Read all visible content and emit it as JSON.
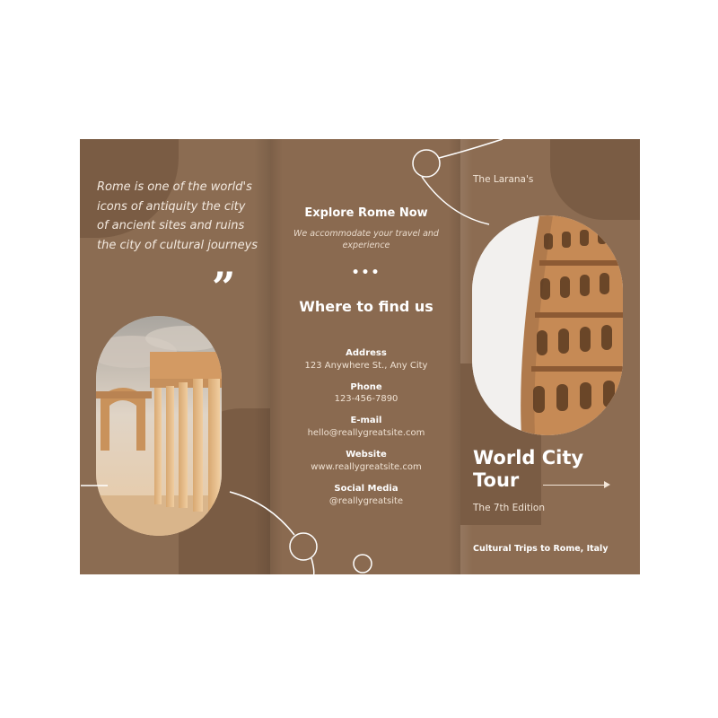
{
  "left_panel": {
    "lead_text": "Rome is one of the world's icons of antiquity the city of ancient sites and ruins the city of cultural journeys",
    "quote_mark": "”"
  },
  "middle_panel": {
    "explore_title": "Explore Rome Now",
    "explore_subtitle": "We accommodate your travel and experience",
    "divider": "•••",
    "where_title": "Where to find us",
    "contacts": [
      {
        "label": "Address",
        "value": "123 Anywhere St., Any City"
      },
      {
        "label": "Phone",
        "value": "123-456-7890"
      },
      {
        "label": "E-mail",
        "value": "hello@reallygreatsite.com"
      },
      {
        "label": "Website",
        "value": "www.reallygreatsite.com"
      },
      {
        "label": "Social Media",
        "value": "@reallygreatsite"
      }
    ]
  },
  "right_panel": {
    "brand": "The Larana's",
    "title": "World City Tour",
    "edition": "The 7th Edition",
    "tagline": "Cultural Trips to Rome, Italy"
  },
  "colors": {
    "panel_brown": "#8a6a50",
    "panel_dark": "#7a5c44",
    "text_light": "#f6ece3",
    "background": "#ffffff"
  }
}
